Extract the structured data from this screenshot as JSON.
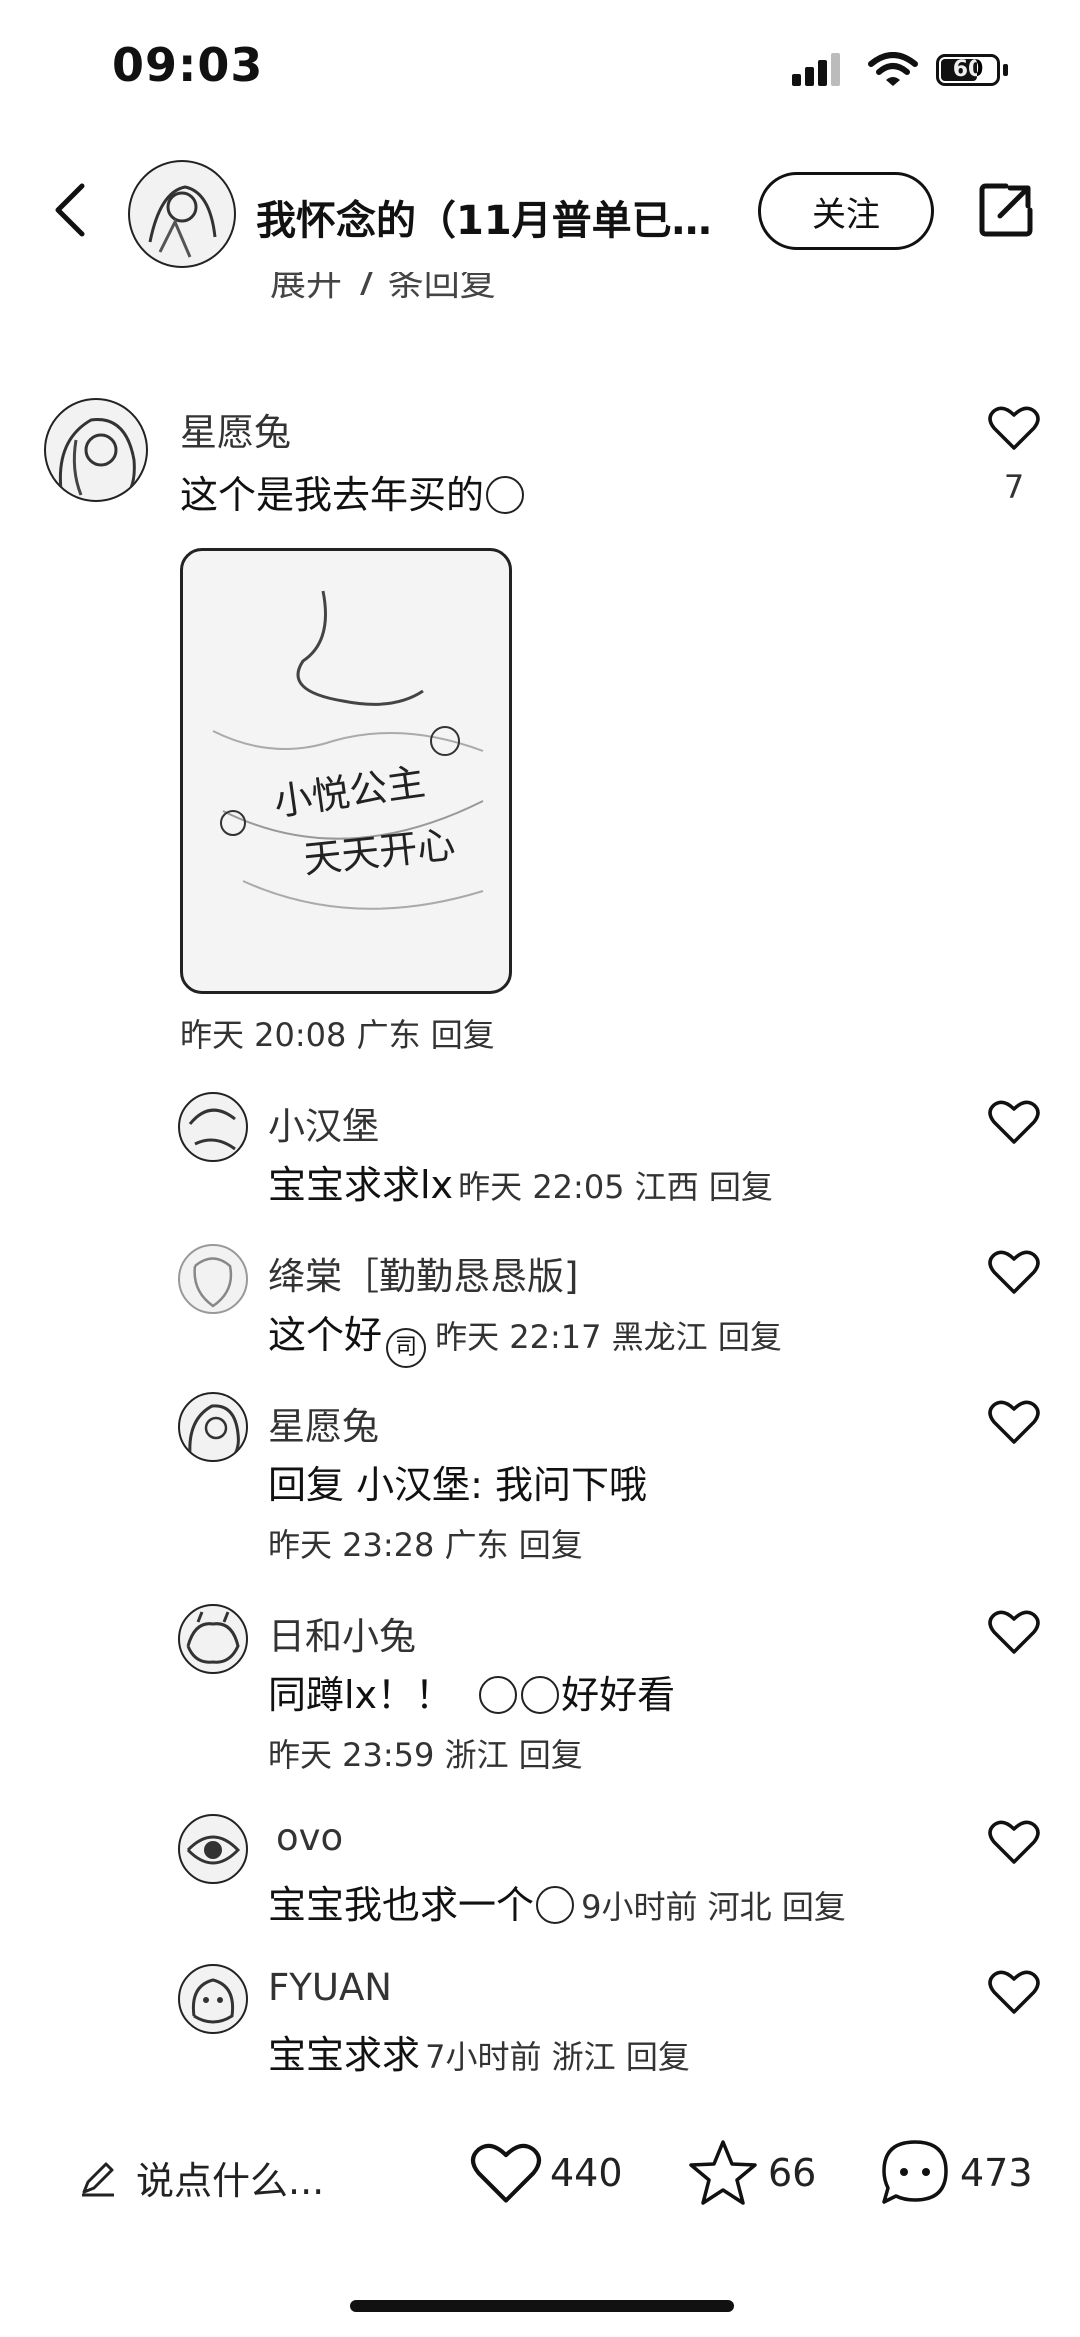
{
  "status_bar": {
    "time": "09:03",
    "battery": "60"
  },
  "header": {
    "title": "我怀念的（11月普单已…",
    "follow_label": "关注"
  },
  "partial_line": "展开 7 条回复",
  "main_comment": {
    "username": "星愿兔",
    "text": "这个是我去年买的",
    "like_count": "7",
    "meta": "昨天 20:08 广东 回复",
    "image_text_line1": "小悦公主",
    "image_text_line2": "天天开心"
  },
  "replies": [
    {
      "username": "小汉堡",
      "text": "宝宝求求lx",
      "meta": "昨天 22:05 江西 回复"
    },
    {
      "username": "绛棠［勤勤恳恳版]",
      "text": "这个好",
      "stamp": "司",
      "meta": "昨天 22:17 黑龙江 回复"
    },
    {
      "username": "星愿兔",
      "text": "回复 小汉堡: 我问下哦",
      "meta": "昨天 23:28 广东 回复"
    },
    {
      "username": "日和小兔",
      "text_a": "同蹲lx！！",
      "text_b": "好好看",
      "meta": "昨天 23:59 浙江 回复"
    },
    {
      "username": "ovo",
      "text": "宝宝我也求一个",
      "meta": "9小时前 河北 回复"
    },
    {
      "username": "FYUAN",
      "text": "宝宝求求",
      "meta": "7小时前 浙江 回复"
    }
  ],
  "bottom_bar": {
    "input_placeholder": "说点什么...",
    "likes": "440",
    "favorites": "66",
    "comments": "473"
  }
}
